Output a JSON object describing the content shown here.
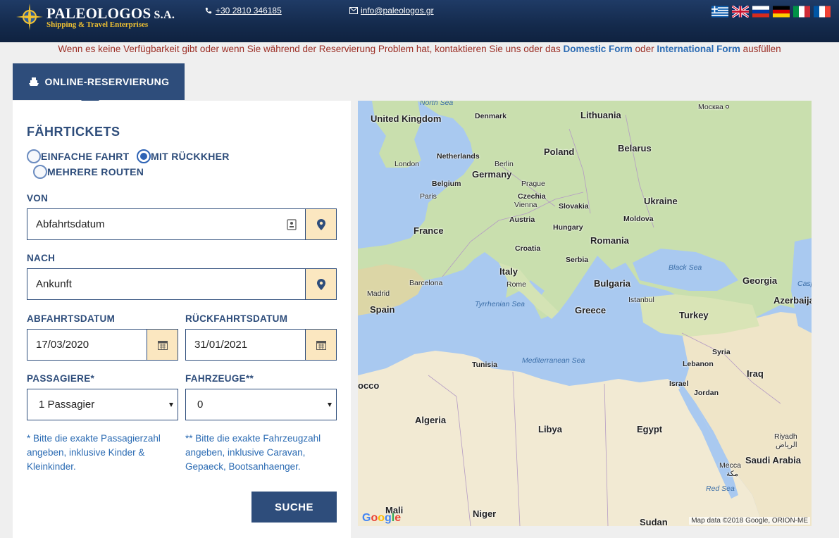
{
  "header": {
    "brand": "PALEOLOGOS",
    "brand_suffix": "S.A.",
    "tagline": "Shipping & Travel Enterprises",
    "phone": "+30 2810 346185",
    "email": "info@paleologos.gr",
    "flags": [
      "Greek",
      "English",
      "Russian",
      "German",
      "Italian",
      "French"
    ]
  },
  "notice": {
    "text_before": "Wenn es keine Verfügbarkeit gibt oder wenn Sie während der Reservierung Problem hat, kontaktieren Sie uns oder das",
    "link1": "Domestic Form",
    "text_middle": "oder",
    "link2": "International Form",
    "text_after": "ausfüllen"
  },
  "tab": {
    "label": "ONLINE-RESERVIERUNG",
    "icon": "ship-icon"
  },
  "form": {
    "title": "FÄHRTICKETS",
    "trip_types": [
      "EINFACHE FAHRT",
      "MIT RÜCKKHER",
      "MEHRERE ROUTEN"
    ],
    "selected_trip_type": "MIT RÜCKKHER",
    "from_label": "VON",
    "from_value": "Abfahrtsdatum",
    "to_label": "NACH",
    "to_value": "Ankunft",
    "departure_label": "ABFAHRTSDATUM",
    "departure_value": "17/03/2020",
    "return_label": "RÜCKFAHRTSDATUM",
    "return_value": "31/01/2021",
    "passengers_label": "PASSAGIERE*",
    "passengers_value": "1 Passagier",
    "vehicles_label": "FAHRZEUGE**",
    "vehicles_value": "0",
    "passengers_note": "* Bitte die exakte Passagierzahl angeben, inklusive Kinder & Kleinkinder.",
    "vehicles_note": "** Bitte die exakte Fahrzeugzahl angeben, inklusive Caravan, Gepaeck, Bootsanhaenger.",
    "search_label": "SUCHE"
  },
  "map": {
    "countries": [
      "United Kingdom",
      "Denmark",
      "Lithuania",
      "Netherlands",
      "Poland",
      "Belarus",
      "Germany",
      "Belgium",
      "Czechia",
      "Slovakia",
      "Ukraine",
      "France",
      "Austria",
      "Hungary",
      "Moldova",
      "Croatia",
      "Romania",
      "Serbia",
      "Italy",
      "Bulgaria",
      "Spain",
      "Greece",
      "Turkey",
      "Georgia",
      "Azerbaija",
      "Syria",
      "Lebanon",
      "Iraq",
      "Israel",
      "Jordan",
      "Tunisia",
      "Algeria",
      "Libya",
      "Egypt",
      "Saudi Arabia",
      "Mali",
      "Niger",
      "Sudan",
      "occo"
    ],
    "cities": [
      "London",
      "Berlin",
      "Paris",
      "Prague",
      "Vienna",
      "Москва",
      "Madrid",
      "Barcelona",
      "Rome",
      "Istanbul",
      "Mecca",
      "Riyadh"
    ],
    "city_native": [
      "الرياض",
      "مكة"
    ],
    "seas": [
      "North Sea",
      "Black Sea",
      "Tyrrhenian Sea",
      "Mediterranean Sea",
      "Red Sea",
      "Casp"
    ],
    "google": "Google",
    "attribution": "Map data ©2018 Google, ORION-ME"
  }
}
